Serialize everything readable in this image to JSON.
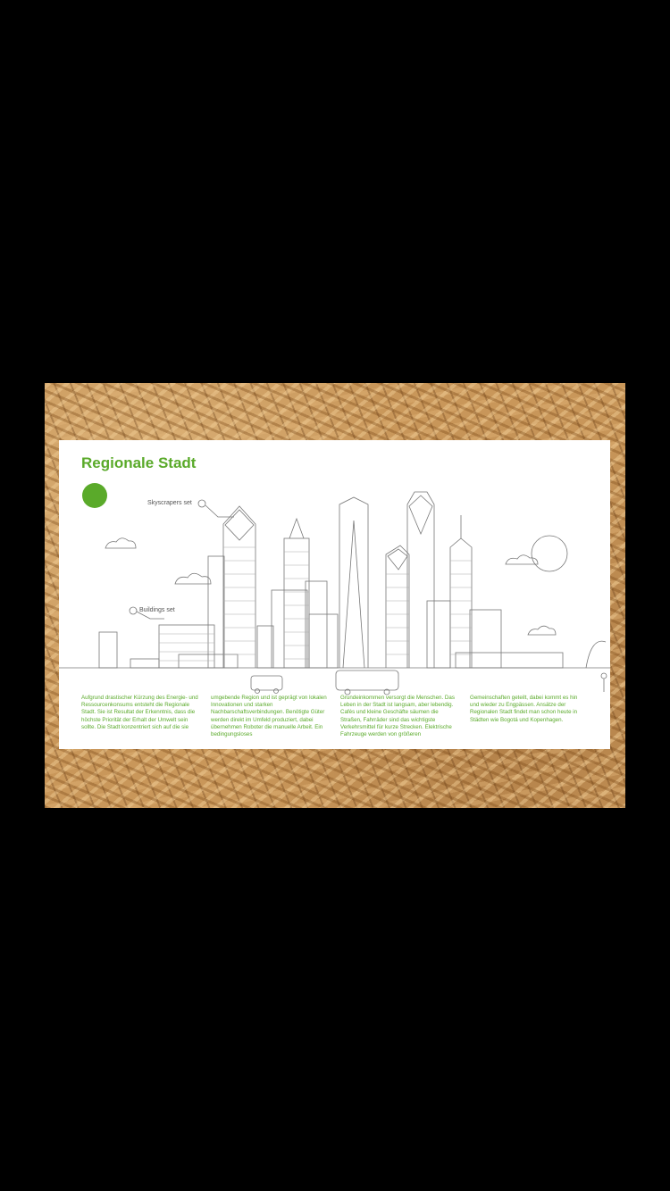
{
  "poster": {
    "title": "Regionale Stadt",
    "label_skyscrapers": "Skyscrapers set",
    "label_buildings": "Buildings set",
    "accent_color": "#5aaa2a",
    "columns": [
      "Aufgrund drastischer Kürzung des Energie- und Ressourcenkonsums entsteht die Regionale Stadt. Sie ist Resultat der Erkenntnis, dass die höchste Priorität der Erhalt der Umwelt sein sollte. Die Stadt konzentriert sich auf die sie",
      "umgebende Region und ist geprägt von lokalen Innovationen und starken Nachbarschaftsverbindungen. Benötigte Güter werden direkt im Umfeld produziert, dabei übernehmen Roboter die manuelle Arbeit. Ein bedingungsloses",
      "Grundeinkommen versorgt die Menschen. Das Leben in der Stadt ist langsam, aber lebendig. Cafés und kleine Geschäfte säumen die Straßen, Fahrräder sind das wichtigste Verkehrsmittel für kurze Strecken. Elektrische Fahrzeuge werden von größeren",
      "Gemeinschaften geteilt, dabei kommt es hin und wieder zu Engpässen. Ansätze der Regionalen Stadt findet man schon heute in Städten wie Bogotá und Kopenhagen."
    ]
  }
}
